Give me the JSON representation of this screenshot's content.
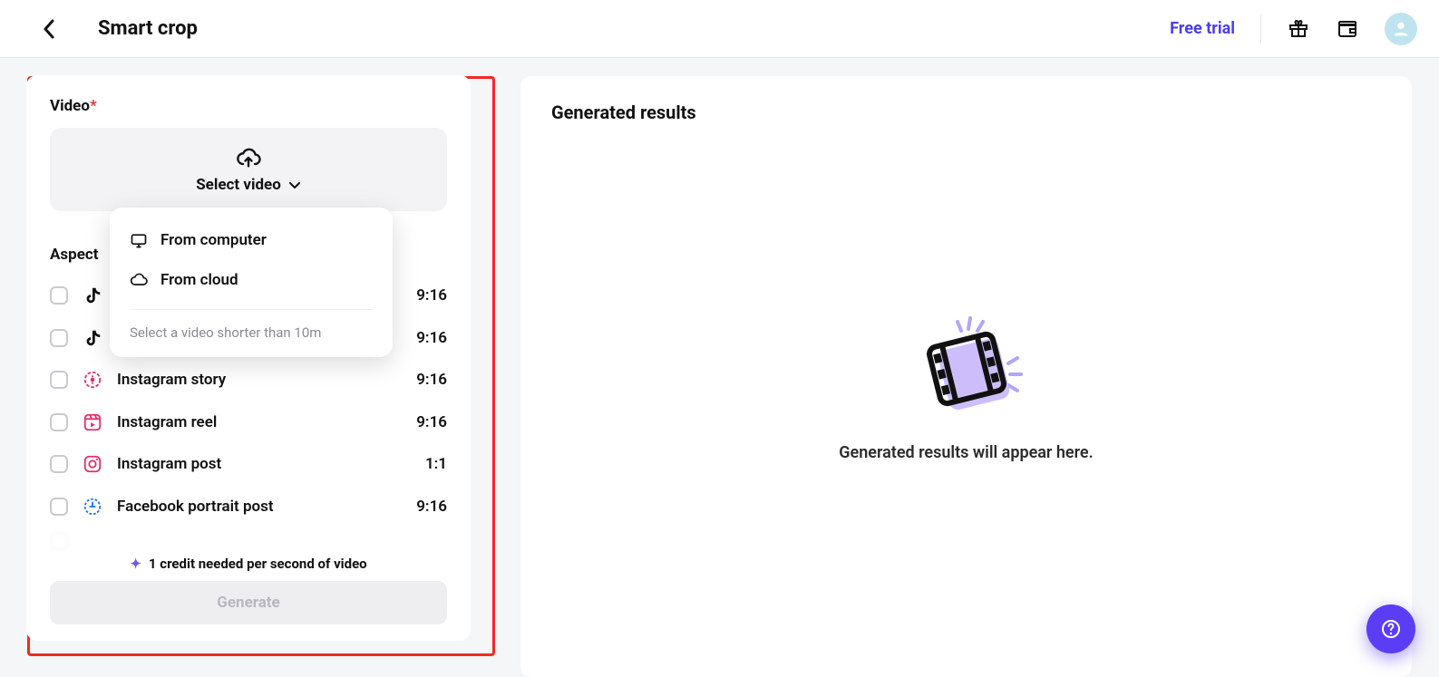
{
  "header": {
    "page_title": "Smart crop",
    "free_trial": "Free trial"
  },
  "sidebar": {
    "video_label": "Video",
    "video_required": "*",
    "upload_label": "Select video",
    "aspect_label": "Aspect",
    "credit_note": "1 credit needed per second of video",
    "generate_label": "Generate",
    "ratios": [
      {
        "name": "",
        "value": "9:16",
        "platform": "tiktok"
      },
      {
        "name": "",
        "value": "9:16",
        "platform": "tiktok"
      },
      {
        "name": "Instagram story",
        "value": "9:16",
        "platform": "instagram-story"
      },
      {
        "name": "Instagram reel",
        "value": "9:16",
        "platform": "instagram-reel"
      },
      {
        "name": "Instagram post",
        "value": "1:1",
        "platform": "instagram-post"
      },
      {
        "name": "Facebook portrait post",
        "value": "9:16",
        "platform": "facebook"
      }
    ]
  },
  "dropdown": {
    "from_computer": "From computer",
    "from_cloud": "From cloud",
    "hint": "Select a video shorter than 10m"
  },
  "results": {
    "title": "Generated results",
    "placeholder": "Generated results will appear here."
  }
}
